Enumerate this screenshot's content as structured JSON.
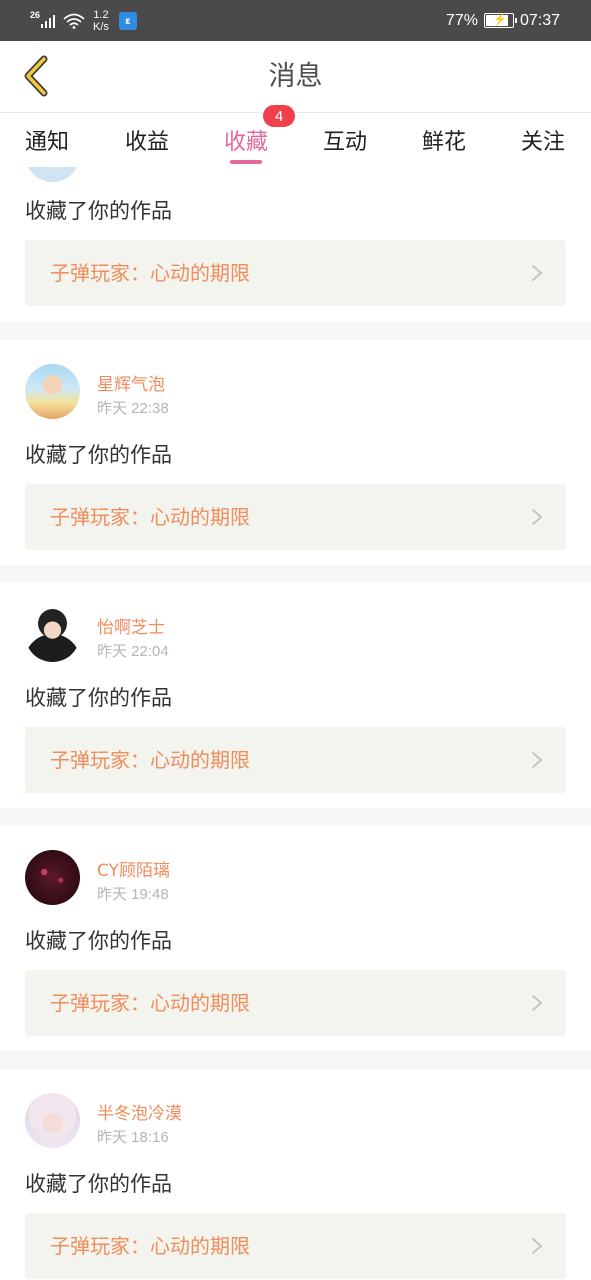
{
  "status_bar": {
    "network": "26",
    "speed_value": "1.2",
    "speed_unit": "K/s",
    "app_icon_glyph": "ε",
    "battery_percent": "77%",
    "time": "07:37"
  },
  "header": {
    "title": "消息",
    "back_icon": "chevron-left-icon",
    "accent_color": "#f0c93c"
  },
  "tabs": {
    "items": [
      {
        "label": "通知"
      },
      {
        "label": "收益"
      },
      {
        "label": "收藏"
      },
      {
        "label": "互动"
      },
      {
        "label": "鲜花"
      },
      {
        "label": "关注"
      }
    ],
    "active_index": 2,
    "active_color": "#e26a9a",
    "badge_count": "4"
  },
  "feed": {
    "partial_item": {
      "action": "收藏了你的作品",
      "work_title": "子弹玩家：心动的期限"
    },
    "items": [
      {
        "user": "星辉气泡",
        "time": "昨天 22:38",
        "action": "收藏了你的作品",
        "work_title": "子弹玩家：心动的期限"
      },
      {
        "user": "怡啊芝士",
        "time": "昨天 22:04",
        "action": "收藏了你的作品",
        "work_title": "子弹玩家：心动的期限"
      },
      {
        "user": "CY顾陌璃",
        "time": "昨天 19:48",
        "action": "收藏了你的作品",
        "work_title": "子弹玩家：心动的期限"
      },
      {
        "user": "半冬泡冷漠",
        "time": "昨天 18:16",
        "action": "收藏了你的作品",
        "work_title": "子弹玩家：心动的期限"
      }
    ]
  },
  "colors": {
    "username": "#ef8d5d",
    "card_bg": "#f4f4ee",
    "separator": "#f7f7f7"
  }
}
